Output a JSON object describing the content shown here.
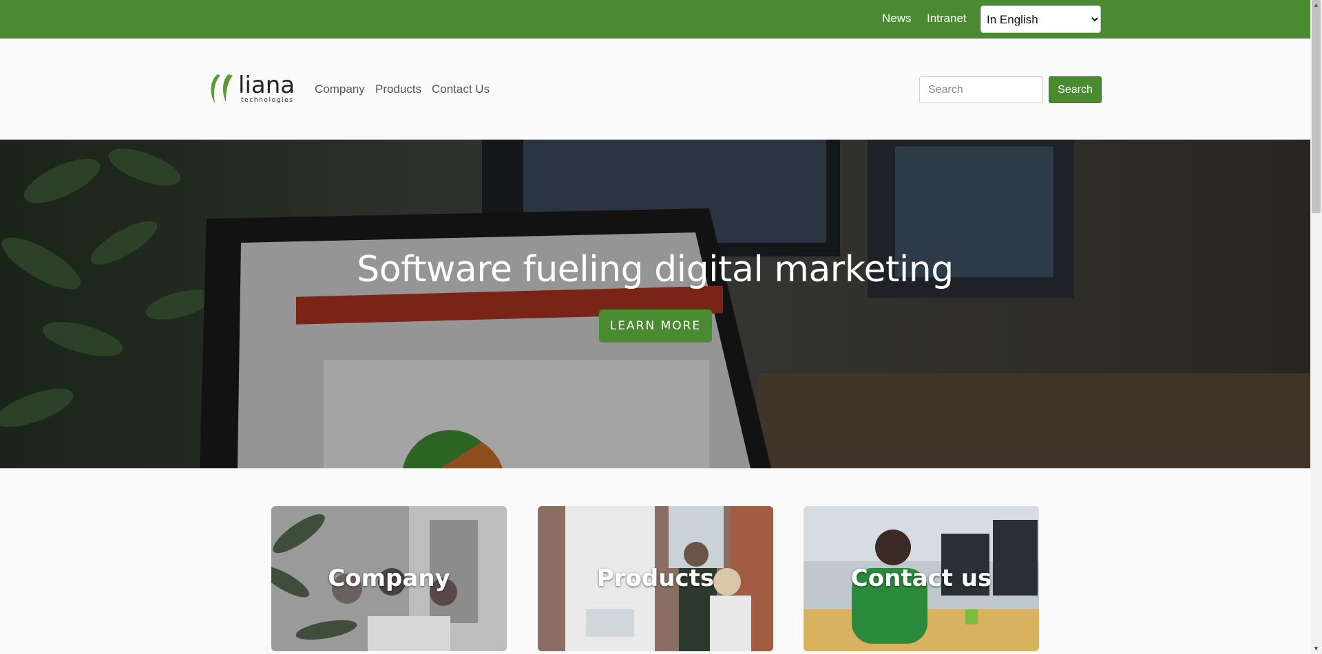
{
  "topbar": {
    "news": "News",
    "intranet": "Intranet",
    "language": {
      "selected": "In English",
      "options": [
        "In English"
      ]
    }
  },
  "header": {
    "logo": {
      "word": "liana",
      "tagline": "technologies"
    },
    "nav": {
      "company": "Company",
      "products": "Products",
      "contact": "Contact Us"
    },
    "search": {
      "placeholder": "Search",
      "button": "Search"
    }
  },
  "hero": {
    "title": "Software fueling digital marketing",
    "button": "LEARN MORE"
  },
  "cards": {
    "company": "Company",
    "products": "Products",
    "contact": "Contact us"
  },
  "colors": {
    "brand_green": "#4a8b32",
    "background": "#fafafa"
  }
}
